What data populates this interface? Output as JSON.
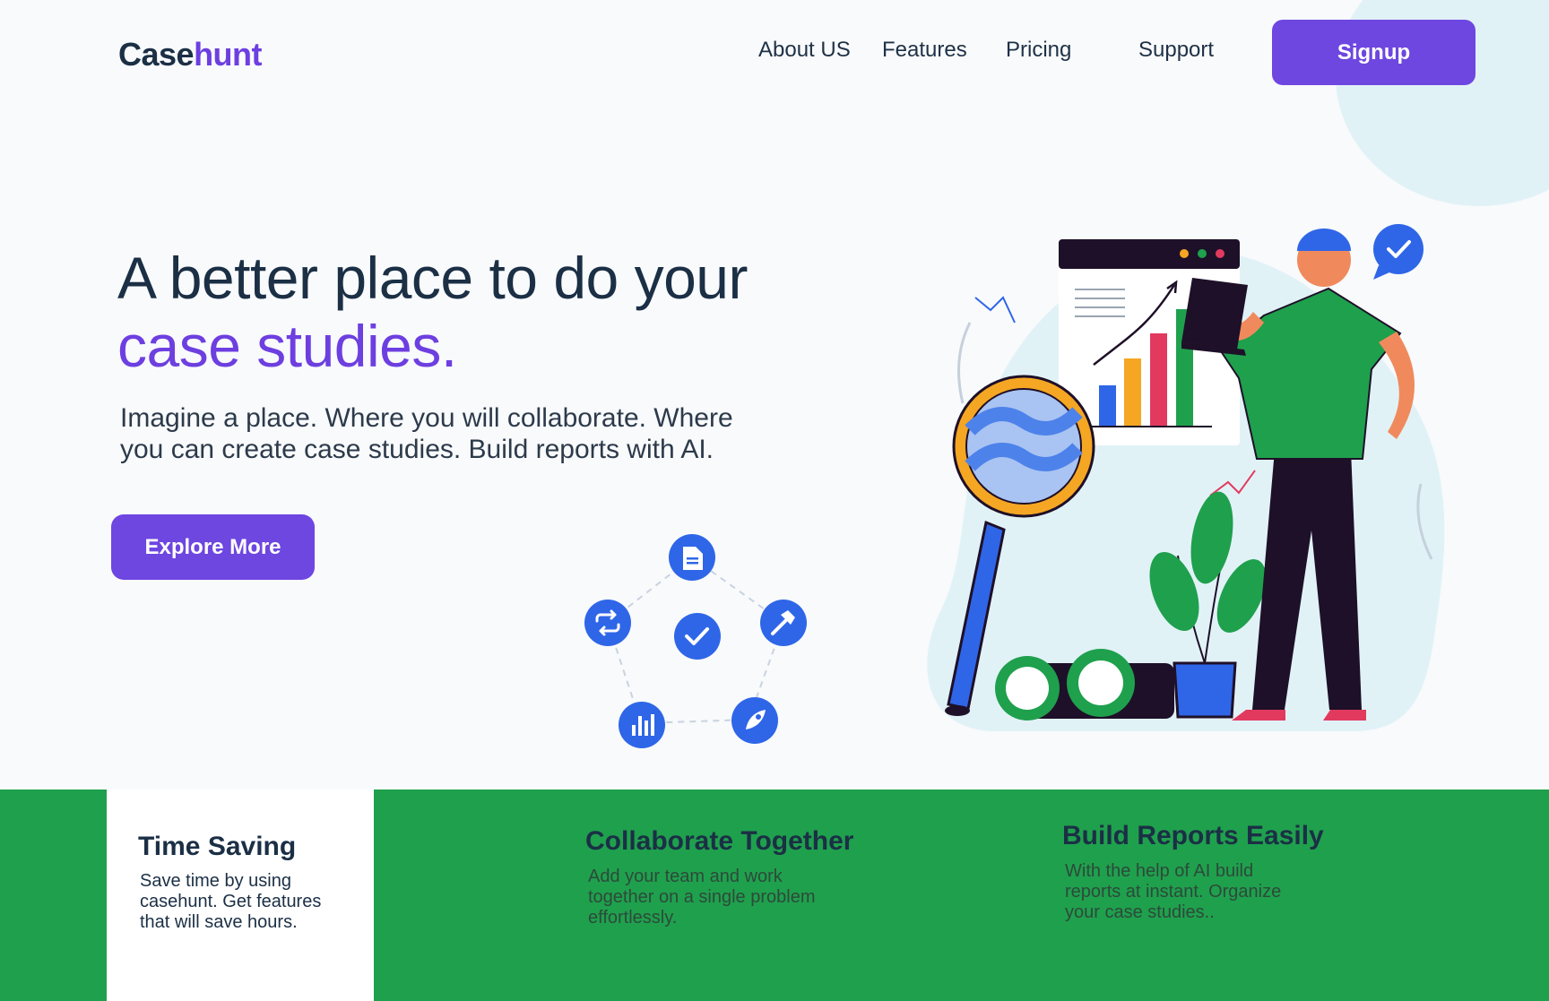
{
  "brand": {
    "part1": "Case",
    "part2": "hunt"
  },
  "nav": {
    "about": "About US",
    "features": "Features",
    "pricing": "Pricing",
    "support": "Support"
  },
  "signup_label": "Signup",
  "hero": {
    "line1": "A better place to do your",
    "line2": "case studies.",
    "description": "Imagine a place. Where you will collaborate. Where you can create case studies. Build reports with AI.",
    "cta": "Explore More"
  },
  "features": [
    {
      "title": "Time Saving",
      "desc": "Save time by using casehunt. Get features that will save hours."
    },
    {
      "title": "Collaborate Together",
      "desc": "Add your team and work together on a single problem effortlessly."
    },
    {
      "title": "Build Reports Easily",
      "desc": "With the help of AI build reports at instant. Organize your case studies.."
    }
  ],
  "colors": {
    "brand_purple": "#6e46e0",
    "navy": "#1b2f45",
    "green": "#1fa04d",
    "icon_blue": "#2f66e8"
  },
  "icons": [
    "document-icon",
    "hammer-icon",
    "rocket-icon",
    "bar-chart-icon",
    "repeat-icon",
    "check-icon"
  ]
}
